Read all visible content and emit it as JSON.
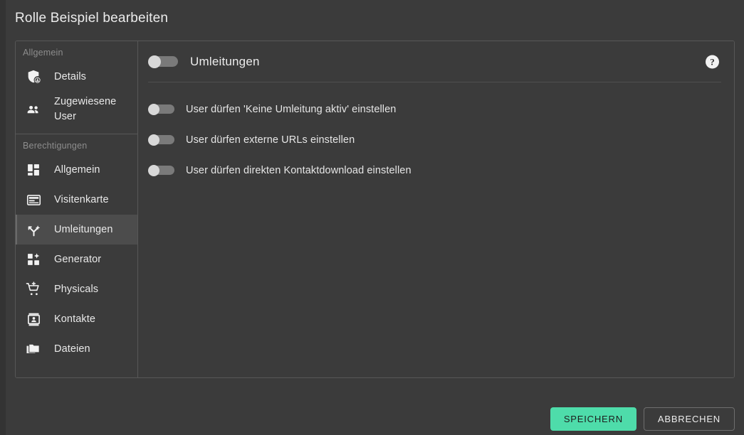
{
  "page": {
    "title": "Rolle Beispiel bearbeiten"
  },
  "sidebar": {
    "groups": [
      {
        "label": "Allgemein",
        "items": [
          {
            "label": "Details",
            "icon": "shield-badge-icon",
            "active": false
          },
          {
            "label": "Zugewiesene User",
            "icon": "people-icon",
            "active": false
          }
        ]
      },
      {
        "label": "Berechtigungen",
        "items": [
          {
            "label": "Allgemein",
            "icon": "dashboard-grid-icon",
            "active": false
          },
          {
            "label": "Visitenkarte",
            "icon": "card-icon",
            "active": false
          },
          {
            "label": "Umleitungen",
            "icon": "fork-arrow-icon",
            "active": true
          },
          {
            "label": "Generator",
            "icon": "grid-sparkle-icon",
            "active": false
          },
          {
            "label": "Physicals",
            "icon": "cart-plus-icon",
            "active": false
          },
          {
            "label": "Kontakte",
            "icon": "contact-card-icon",
            "active": false
          },
          {
            "label": "Dateien",
            "icon": "folders-icon",
            "active": false
          }
        ]
      }
    ]
  },
  "content": {
    "header": {
      "title": "Umleitungen",
      "toggle_on": false,
      "help_glyph": "?"
    },
    "options": [
      {
        "label": "User dürfen 'Keine Umleitung aktiv' einstellen",
        "toggle_on": false
      },
      {
        "label": "User dürfen externe URLs einstellen",
        "toggle_on": false
      },
      {
        "label": "User dürfen direkten Kontaktdownload einstellen",
        "toggle_on": false
      }
    ]
  },
  "footer": {
    "save_label": "SPEICHERN",
    "cancel_label": "ABBRECHEN"
  },
  "colors": {
    "background": "#3b3b3b",
    "accent_save": "#4edcaa",
    "active_nav": "#4c4c4c",
    "border": "#575757"
  }
}
